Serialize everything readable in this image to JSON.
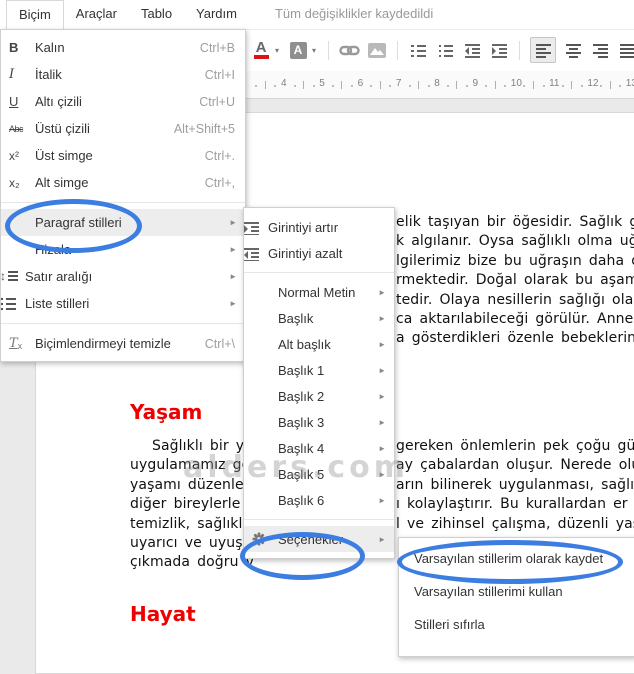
{
  "menubar": {
    "items": [
      {
        "name": "format",
        "label": "Biçim",
        "active": true
      },
      {
        "name": "tools",
        "label": "Araçlar",
        "active": false
      },
      {
        "name": "table",
        "label": "Tablo",
        "active": false
      },
      {
        "name": "help",
        "label": "Yardım",
        "active": false
      }
    ],
    "status": "Tüm değişiklikler kaydedildi"
  },
  "toolbar": {
    "text_color_glyph": "A",
    "highlight_glyph": "A",
    "pressed": "align-left",
    "icons": [
      "text-color-icon",
      "highlight-color-icon",
      "insert-link-icon",
      "insert-image-icon",
      "numbered-list-icon",
      "bulleted-list-icon",
      "decrease-indent-icon",
      "increase-indent-icon",
      "align-left-icon",
      "align-center-icon",
      "align-right-icon",
      "justify-icon",
      "line-spacing-icon"
    ]
  },
  "ruler": {
    "numbers": [
      "4",
      "5",
      "6",
      "7",
      "8",
      "9",
      "10",
      "11",
      "12",
      "13"
    ]
  },
  "format_menu": {
    "items": [
      {
        "name": "bold",
        "icon": "bold-icon",
        "label": "Kalın",
        "shortcut": "Ctrl+B"
      },
      {
        "name": "italic",
        "icon": "italic-icon",
        "label": "İtalik",
        "shortcut": "Ctrl+I"
      },
      {
        "name": "underline",
        "icon": "underline-icon",
        "label": "Altı çizili",
        "shortcut": "Ctrl+U"
      },
      {
        "name": "strikethrough",
        "icon": "strikethrough-icon",
        "label": "Üstü çizili",
        "shortcut": "Alt+Shift+5"
      },
      {
        "name": "superscript",
        "icon": "superscript-icon",
        "label": "Üst simge",
        "shortcut": "Ctrl+."
      },
      {
        "name": "subscript",
        "icon": "subscript-icon",
        "label": "Alt simge",
        "shortcut": "Ctrl+,"
      },
      {
        "type": "separator"
      },
      {
        "name": "paragraph-styles",
        "label": "Paragraf stilleri",
        "submenu": true,
        "highlighted": true
      },
      {
        "name": "align",
        "label": "Hizala",
        "submenu": true
      },
      {
        "name": "line-spacing",
        "icon": "line-spacing-icon",
        "label": "Satır aralığı",
        "submenu": true
      },
      {
        "name": "list-styles",
        "icon": "list-icon",
        "label": "Liste stilleri",
        "submenu": true
      },
      {
        "type": "separator"
      },
      {
        "name": "clear-formatting",
        "icon": "clear-formatting-icon",
        "label": "Biçimlendirmeyi temizle",
        "shortcut": "Ctrl+\\"
      }
    ]
  },
  "styles_submenu": {
    "items": [
      {
        "name": "increase-indent",
        "icon": "indent-increase-icon",
        "label": "Girintiyi artır"
      },
      {
        "name": "decrease-indent",
        "icon": "indent-decrease-icon",
        "label": "Girintiyi azalt"
      },
      {
        "type": "separator"
      },
      {
        "name": "normal-text",
        "label": "Normal Metin",
        "submenu": true
      },
      {
        "name": "title",
        "label": "Başlık",
        "submenu": true
      },
      {
        "name": "subtitle",
        "label": "Alt başlık",
        "submenu": true
      },
      {
        "name": "heading-1",
        "label": "Başlık 1",
        "submenu": true
      },
      {
        "name": "heading-2",
        "label": "Başlık 2",
        "submenu": true
      },
      {
        "name": "heading-3",
        "label": "Başlık 3",
        "submenu": true
      },
      {
        "name": "heading-4",
        "label": "Başlık 4",
        "submenu": true
      },
      {
        "name": "heading-5",
        "label": "Başlık 5",
        "submenu": true
      },
      {
        "name": "heading-6",
        "label": "Başlık 6",
        "submenu": true
      },
      {
        "type": "separator"
      },
      {
        "name": "options",
        "icon": "gear-icon",
        "label": "Seçenekler",
        "submenu": true,
        "highlighted": true
      }
    ]
  },
  "options_submenu": {
    "items": [
      {
        "name": "save-default-styles",
        "label": "Varsayılan stillerim olarak kaydet"
      },
      {
        "name": "use-default-styles",
        "label": "Varsayılan stillerimi kullan"
      },
      {
        "name": "reset-styles",
        "label": "Stilleri sıfırla"
      }
    ]
  },
  "document": {
    "heading1": "Yaşam",
    "heading2": "Hayat",
    "heading_color": "#ee0000",
    "para1_right_lines": [
      "elik taşıyan bir öğesidir. Sağlık gene",
      "k algılanır. Oysa sağlıklı olma uğrund",
      "lgilerimiz bize bu uğraşın daha doğr",
      "rmektedir. Doğal olarak bu aşamad",
      "tedir. Olaya nesillerin sağlığı olarak",
      "ca aktarılabileceği görülür. Anne ve",
      "a gösterdikleri özenle bebeklerine s"
    ],
    "para2_left_lines": [
      "Sağlıklı bir y",
      "uygulamamız ge",
      "yaşamı düzenley",
      "diğer bireylerle",
      "temizlik, sağlıklı",
      "uyarıcı ve uyuşt",
      "çıkmada doğru v"
    ],
    "para2_right_lines": [
      "gereken önlemlerin pek çoğu gün",
      "ay çabalardan oluşur. Nerede olu",
      "arın bilinerek uygulanması, sağlığ",
      "ı kolaylaştırır. Bu kurallardan er",
      "l ve zihinsel çalışma, düzenli yaşa",
      "",
      ""
    ]
  },
  "watermark": "alders.com",
  "annotations": {
    "color": "#3b7de0",
    "circled": [
      "Paragraf stilleri",
      "Seçenekler",
      "Varsayılan stillerim olarak kaydet"
    ]
  }
}
